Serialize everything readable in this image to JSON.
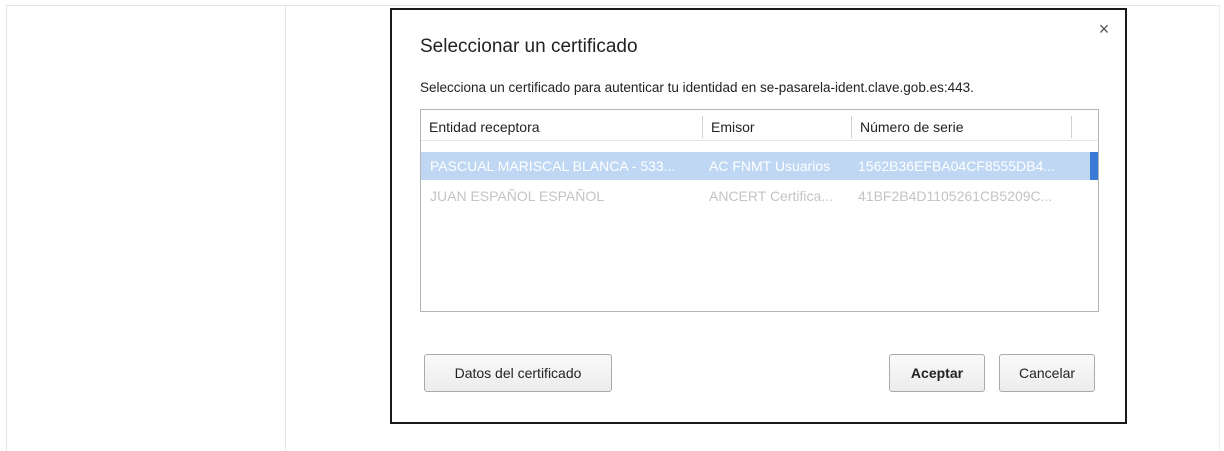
{
  "dialog": {
    "title": "Seleccionar un certificado",
    "description": "Selecciona un certificado para autenticar tu identidad en se-pasarela-ident.clave.gob.es:443.",
    "close_glyph": "×"
  },
  "table": {
    "columns": [
      "Entidad receptora",
      "Emisor",
      "Número de serie"
    ],
    "rows": [
      {
        "subject": "PASCUAL MARISCAL BLANCA - 533...",
        "issuer": "AC FNMT Usuarios",
        "serial": "1562B36EFBA04CF8555DB4...",
        "selected": true
      },
      {
        "subject": "JUAN ESPAÑOL ESPAÑOL",
        "issuer": "ANCERT Certifica...",
        "serial": "41BF2B4D1105261CB5209C...",
        "selected": false
      }
    ]
  },
  "buttons": {
    "details": "Datos del certificado",
    "accept": "Aceptar",
    "cancel": "Cancelar"
  },
  "colors": {
    "selection": "#bfd7f3",
    "selection_marker": "#3a7bd5"
  }
}
